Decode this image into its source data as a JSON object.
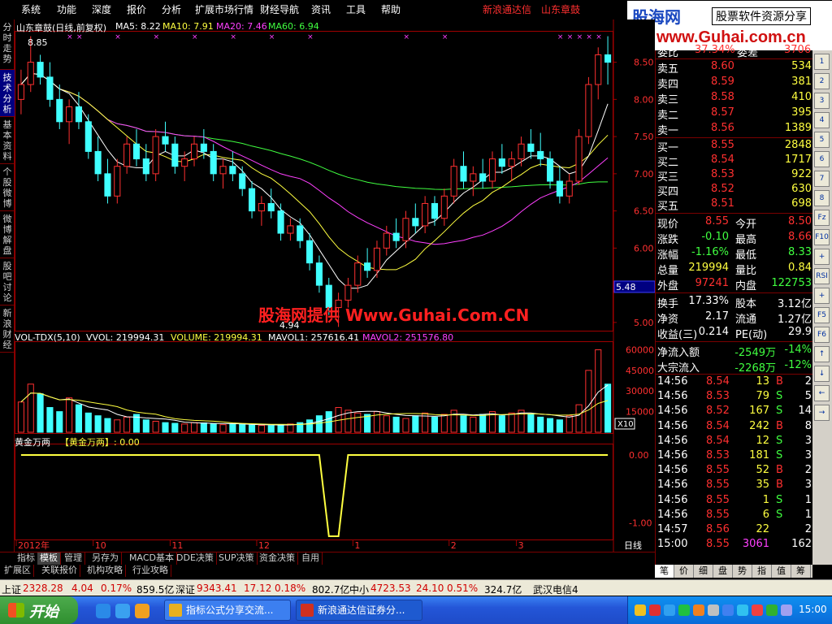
{
  "menu": {
    "items": [
      "系统",
      "功能",
      "深度",
      "报价",
      "分析",
      "扩展市场行情",
      "财经导航",
      "资讯",
      "工具",
      "帮助"
    ],
    "broker": "新浪通达信",
    "stock_name": "山东章鼓"
  },
  "logo": {
    "name": "股海网",
    "slogan": "股票软件资源分享",
    "url": "www.Guhai.com.cn"
  },
  "left_tabs": [
    "分时走势",
    "技术分析",
    "基本资料",
    "个股微博",
    "微博解盘",
    "股吧讨论",
    "新浪财经"
  ],
  "chart": {
    "title": "山东章鼓(日线,前复权)",
    "ma5": "MA5: 8.22",
    "ma10": "MA10: 7.91",
    "ma20": "MA20: 7.46",
    "ma60": "MA60: 6.94",
    "high_marker": "8.85",
    "low_marker": "4.94",
    "current_price_tag": "5.48",
    "price_axis": [
      "8.50",
      "8.00",
      "7.50",
      "7.00",
      "6.50",
      "6.00",
      "5.50",
      "5.00"
    ],
    "watermark": "股海网提供 Www.Guhai.Com.CN",
    "volume_title": "VOL-TDX(5,10)",
    "vvol": "VVOL: 219994.31",
    "volume": "VOLUME: 219994.31",
    "mavol1": "MAVOL1: 257616.41",
    "mavol2": "MAVOL2: 251576.80",
    "volume_axis": [
      "60000",
      "45000",
      "30000",
      "15000"
    ],
    "volume_unit": "X10",
    "indicator_title": "黄金万两",
    "indicator_value": "【黄金万两】: 0.00",
    "indicator_axis": [
      "0.00",
      "-1.00"
    ],
    "dates": [
      "2012年",
      "10",
      "11",
      "12",
      "1",
      "2",
      "3"
    ],
    "period": "日线",
    "colors": {
      "up": "#ff3030",
      "down": "#40ffff",
      "ma5": "#ffffff",
      "ma10": "#ffff40",
      "ma20": "#ff40ff",
      "ma60": "#40ff40",
      "indicator": "#ffff40"
    }
  },
  "chart_data": {
    "type": "candlestick",
    "title": "山东章鼓(日线,前复权)",
    "ylim": [
      4.9,
      8.9
    ],
    "candles": [
      [
        8.0,
        8.4,
        7.8,
        8.2
      ],
      [
        8.2,
        8.85,
        8.1,
        8.5
      ],
      [
        8.5,
        8.6,
        8.2,
        8.3
      ],
      [
        8.3,
        8.5,
        7.9,
        8.0
      ],
      [
        8.0,
        8.2,
        7.6,
        7.7
      ],
      [
        7.7,
        8.0,
        7.4,
        7.9
      ],
      [
        7.9,
        8.1,
        7.6,
        7.7
      ],
      [
        7.7,
        7.8,
        7.2,
        7.3
      ],
      [
        7.3,
        7.5,
        6.9,
        7.0
      ],
      [
        7.0,
        7.2,
        6.6,
        6.7
      ],
      [
        6.7,
        7.2,
        6.6,
        7.1
      ],
      [
        7.1,
        7.5,
        7.0,
        7.4
      ],
      [
        7.4,
        7.6,
        7.1,
        7.2
      ],
      [
        7.2,
        7.4,
        6.9,
        7.0
      ],
      [
        7.0,
        7.6,
        6.9,
        7.5
      ],
      [
        7.5,
        7.7,
        7.3,
        7.4
      ],
      [
        7.4,
        7.5,
        7.0,
        7.1
      ],
      [
        7.1,
        7.3,
        6.9,
        7.2
      ],
      [
        7.2,
        7.5,
        7.1,
        7.4
      ],
      [
        7.4,
        7.6,
        7.2,
        7.3
      ],
      [
        7.3,
        7.4,
        6.9,
        7.0
      ],
      [
        7.0,
        7.2,
        6.8,
        7.1
      ],
      [
        7.1,
        7.3,
        6.9,
        7.0
      ],
      [
        7.0,
        7.1,
        6.7,
        6.8
      ],
      [
        6.8,
        6.9,
        6.4,
        6.5
      ],
      [
        6.5,
        6.7,
        6.3,
        6.6
      ],
      [
        6.6,
        6.8,
        6.4,
        6.5
      ],
      [
        6.5,
        6.6,
        6.1,
        6.2
      ],
      [
        6.2,
        6.4,
        6.1,
        6.3
      ],
      [
        6.3,
        6.4,
        6.0,
        6.1
      ],
      [
        6.1,
        6.2,
        5.7,
        5.8
      ],
      [
        5.8,
        5.9,
        5.4,
        5.5
      ],
      [
        5.5,
        5.6,
        5.1,
        5.2
      ],
      [
        5.2,
        5.4,
        4.94,
        5.3
      ],
      [
        5.3,
        5.6,
        5.2,
        5.5
      ],
      [
        5.5,
        5.9,
        5.4,
        5.8
      ],
      [
        5.8,
        6.0,
        5.6,
        5.7
      ],
      [
        5.7,
        6.1,
        5.6,
        6.0
      ],
      [
        6.0,
        6.3,
        5.9,
        6.2
      ],
      [
        6.2,
        6.4,
        6.0,
        6.1
      ],
      [
        6.1,
        6.5,
        6.0,
        6.4
      ],
      [
        6.4,
        6.6,
        6.2,
        6.3
      ],
      [
        6.3,
        6.7,
        6.2,
        6.6
      ],
      [
        6.6,
        6.7,
        6.3,
        6.4
      ],
      [
        6.4,
        6.8,
        6.3,
        6.7
      ],
      [
        6.7,
        7.2,
        6.6,
        7.1
      ],
      [
        7.1,
        7.3,
        6.8,
        6.9
      ],
      [
        6.9,
        7.1,
        6.7,
        7.0
      ],
      [
        7.0,
        7.2,
        6.8,
        6.9
      ],
      [
        6.9,
        7.3,
        6.8,
        7.2
      ],
      [
        7.2,
        7.4,
        7.0,
        7.1
      ],
      [
        7.1,
        7.3,
        6.9,
        7.2
      ],
      [
        7.2,
        7.5,
        7.1,
        7.4
      ],
      [
        7.4,
        7.6,
        7.2,
        7.3
      ],
      [
        7.3,
        7.55,
        7.1,
        7.2
      ],
      [
        7.2,
        7.3,
        6.8,
        6.9
      ],
      [
        6.9,
        7.1,
        6.6,
        6.7
      ],
      [
        6.7,
        7.0,
        6.6,
        6.9
      ],
      [
        6.9,
        7.6,
        6.85,
        7.5
      ],
      [
        7.5,
        8.3,
        7.4,
        8.2
      ],
      [
        8.2,
        8.7,
        8.0,
        8.6
      ],
      [
        8.6,
        8.85,
        8.2,
        8.5
      ]
    ],
    "volume": [
      22000,
      35000,
      28000,
      18000,
      15000,
      25000,
      20000,
      14000,
      12000,
      10000,
      9000,
      11000,
      13000,
      9000,
      8000,
      7000,
      6500,
      6000,
      7000,
      6800,
      6000,
      5500,
      6000,
      5800,
      5200,
      5000,
      4800,
      5500,
      6000,
      7000,
      9000,
      12000,
      15000,
      18000,
      16000,
      14000,
      13000,
      15000,
      12000,
      11000,
      10000,
      12000,
      14000,
      11000,
      13000,
      16000,
      12000,
      11000,
      13000,
      15000,
      12000,
      14000,
      16000,
      13000,
      11000,
      10000,
      9000,
      12000,
      20000,
      45000,
      60000,
      35000
    ],
    "indicator": {
      "name": "黄金万两",
      "current": 0.0,
      "min": -1.2
    }
  },
  "quote": {
    "weibi_label": "委比",
    "weibi_val": "37.34%",
    "weicha_label": "委差",
    "weicha_val": "3706",
    "sells": [
      {
        "label": "卖五",
        "price": "8.60",
        "vol": "534"
      },
      {
        "label": "卖四",
        "price": "8.59",
        "vol": "381"
      },
      {
        "label": "卖三",
        "price": "8.58",
        "vol": "410"
      },
      {
        "label": "卖二",
        "price": "8.57",
        "vol": "395"
      },
      {
        "label": "卖一",
        "price": "8.56",
        "vol": "1389"
      }
    ],
    "buys": [
      {
        "label": "买一",
        "price": "8.55",
        "vol": "2848"
      },
      {
        "label": "买二",
        "price": "8.54",
        "vol": "1717"
      },
      {
        "label": "买三",
        "price": "8.53",
        "vol": "922"
      },
      {
        "label": "买四",
        "price": "8.52",
        "vol": "630"
      },
      {
        "label": "买五",
        "price": "8.51",
        "vol": "698"
      }
    ],
    "stats": [
      {
        "l1": "现价",
        "v1": "8.55",
        "c1": "up",
        "l2": "今开",
        "v2": "8.50",
        "c2": "up"
      },
      {
        "l1": "涨跌",
        "v1": "-0.10",
        "c1": "dn",
        "l2": "最高",
        "v2": "8.66",
        "c2": "up"
      },
      {
        "l1": "涨幅",
        "v1": "-1.16%",
        "c1": "dn",
        "l2": "最低",
        "v2": "8.33",
        "c2": "dn"
      },
      {
        "l1": "总量",
        "v1": "219994",
        "c1": "yl",
        "l2": "量比",
        "v2": "0.84",
        "c2": "yl"
      },
      {
        "l1": "外盘",
        "v1": "97241",
        "c1": "up",
        "l2": "内盘",
        "v2": "122753",
        "c2": "dn"
      }
    ],
    "fin": [
      {
        "l1": "换手",
        "v1": "17.33%",
        "l2": "股本",
        "v2": "3.12亿"
      },
      {
        "l1": "净资",
        "v1": "2.17",
        "l2": "流通",
        "v2": "1.27亿"
      },
      {
        "l1": "收益(三)",
        "v1": "0.214",
        "l2": "PE(动)",
        "v2": "29.9"
      }
    ],
    "flow": [
      {
        "label": "净流入额",
        "val": "-2549万",
        "pct": "-14%"
      },
      {
        "label": "大宗流入",
        "val": "-2268万",
        "pct": "-12%"
      }
    ],
    "ticks": [
      {
        "t": "14:56",
        "p": "8.54",
        "v": "13",
        "d": "B",
        "n": "2"
      },
      {
        "t": "14:56",
        "p": "8.53",
        "v": "79",
        "d": "S",
        "n": "5"
      },
      {
        "t": "14:56",
        "p": "8.52",
        "v": "167",
        "d": "S",
        "n": "14"
      },
      {
        "t": "14:56",
        "p": "8.54",
        "v": "242",
        "d": "B",
        "n": "8"
      },
      {
        "t": "14:56",
        "p": "8.54",
        "v": "12",
        "d": "S",
        "n": "3"
      },
      {
        "t": "14:56",
        "p": "8.53",
        "v": "181",
        "d": "S",
        "n": "3"
      },
      {
        "t": "14:56",
        "p": "8.55",
        "v": "52",
        "d": "B",
        "n": "2"
      },
      {
        "t": "14:56",
        "p": "8.55",
        "v": "35",
        "d": "B",
        "n": "3"
      },
      {
        "t": "14:56",
        "p": "8.55",
        "v": "1",
        "d": "S",
        "n": "1"
      },
      {
        "t": "14:56",
        "p": "8.55",
        "v": "6",
        "d": "S",
        "n": "1"
      },
      {
        "t": "14:57",
        "p": "8.56",
        "v": "22",
        "d": "",
        "n": "2"
      },
      {
        "t": "15:00",
        "p": "8.55",
        "v": "3061",
        "d": "",
        "n": "162"
      }
    ]
  },
  "right_tools": [
    "1",
    "2",
    "3",
    "4",
    "5",
    "6",
    "7",
    "8",
    "Fz",
    "F10",
    "+",
    "RSI",
    "+",
    "F5",
    "F6",
    "↑",
    "↓",
    "←",
    "→"
  ],
  "bottom_tabs": [
    "指标",
    "模板",
    "管理",
    "另存为",
    "MACD基本",
    "DDE决策",
    "SUP决策",
    "资金决策",
    "自用"
  ],
  "bottom_tabs2": [
    "扩展区",
    "关联报价",
    "机构攻略",
    "行业攻略"
  ],
  "quote_tabs": [
    "笔",
    "价",
    "细",
    "盘",
    "势",
    "指",
    "值",
    "筹"
  ],
  "status": {
    "sh_label": "上证",
    "sh_val": "2328.28",
    "sh_chg": "4.04",
    "sh_pct": "0.17%",
    "sh_amt": "859.5亿",
    "sz_label": "深证",
    "sz_val": "9343.41",
    "sz_chg": "17.12",
    "sz_pct": "0.18%",
    "sz_amt": "802.7亿",
    "zx_label": "中小",
    "zx_val": "4723.53",
    "zx_chg": "24.10",
    "zx_pct": "0.51%",
    "zx_amt": "324.7亿",
    "news": "武汉电信4"
  },
  "taskbar": {
    "start": "开始",
    "tasks": [
      "指标公式分享交流...",
      "新浪通达信证券分..."
    ],
    "clock": "15:00"
  }
}
